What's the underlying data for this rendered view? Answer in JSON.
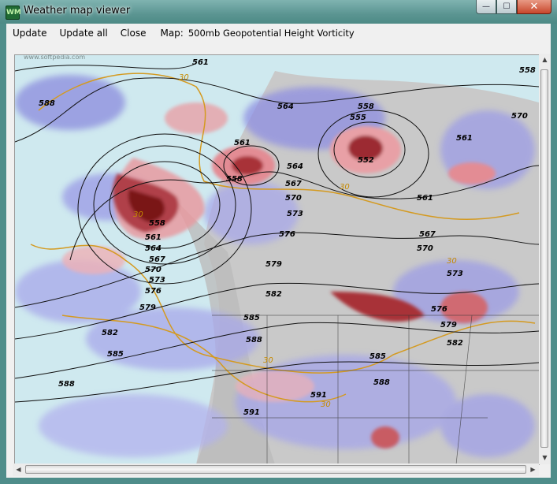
{
  "window": {
    "title": "Weather map viewer",
    "controls": {
      "minimize": "—",
      "maximize": "☐",
      "close": "✕"
    }
  },
  "menu": {
    "update": "Update",
    "update_all": "Update all",
    "close": "Close",
    "map_label": "Map:",
    "map_value": "500mb Geopotential Height  Vorticity"
  },
  "watermark": "www.softpedia.com",
  "contour_labels": [
    "561",
    "558",
    "588",
    "564",
    "555",
    "558",
    "552",
    "561",
    "561",
    "564",
    "567",
    "558",
    "561",
    "570",
    "573",
    "570",
    "576",
    "567",
    "570",
    "558",
    "561",
    "564",
    "567",
    "570",
    "573",
    "576",
    "579",
    "582",
    "579",
    "573",
    "576",
    "579",
    "582",
    "585",
    "588",
    "582",
    "585",
    "588",
    "585",
    "588",
    "591",
    "591"
  ],
  "thickness_labels": [
    "30",
    "30",
    "30",
    "30",
    "30",
    "30"
  ]
}
